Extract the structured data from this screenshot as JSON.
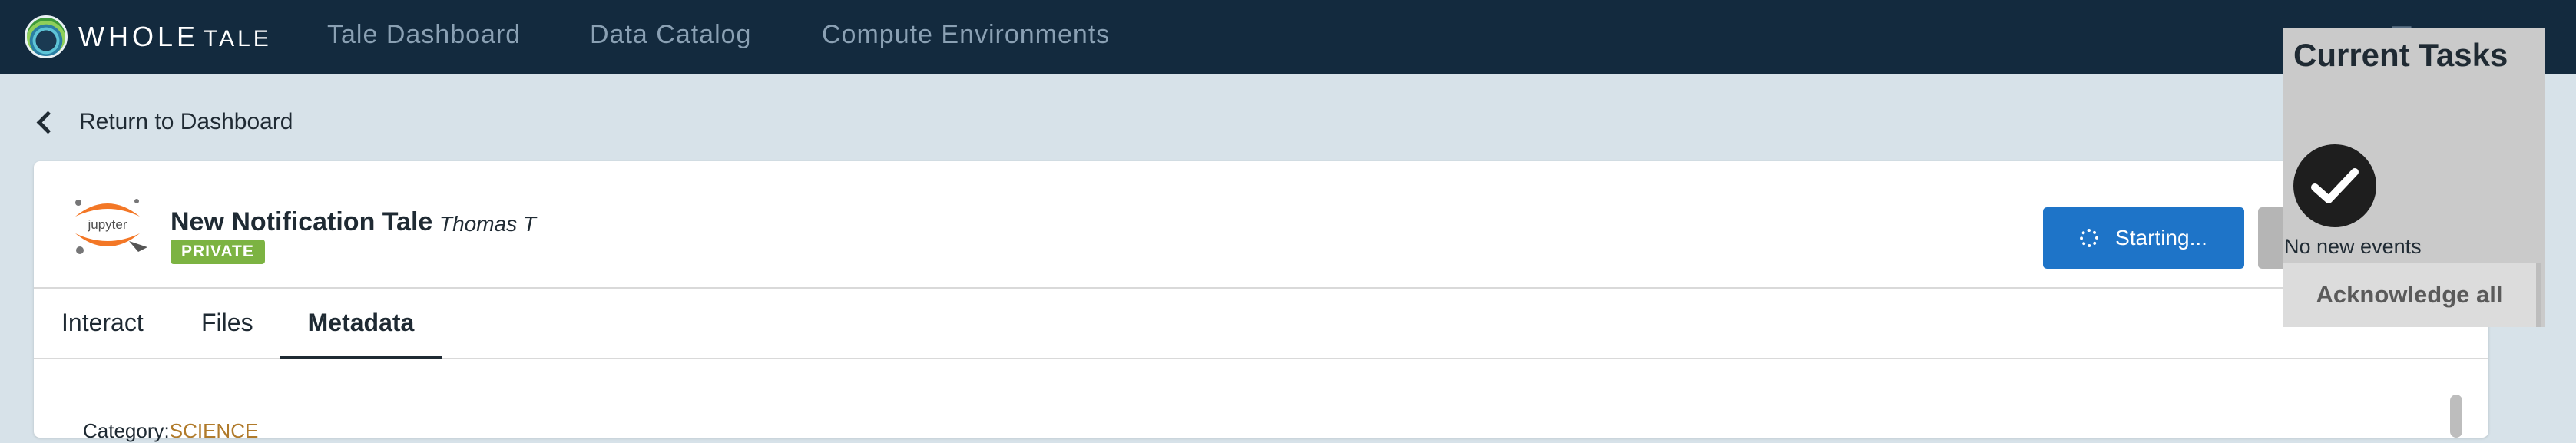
{
  "app": {
    "logo_word_1": "WHOLE",
    "logo_word_2": "TALE"
  },
  "nav": {
    "items": [
      "Tale Dashboard",
      "Data Catalog",
      "Compute Environments"
    ]
  },
  "return_link": "Return to Dashboard",
  "tale": {
    "icon_text": "jupyter",
    "title": "New Notification Tale",
    "author": "Thomas T",
    "visibility": "PRIVATE",
    "start_button": "Starting..."
  },
  "tabs": [
    {
      "label": "Interact",
      "active": false
    },
    {
      "label": "Files",
      "active": false
    },
    {
      "label": "Metadata",
      "active": true
    }
  ],
  "metadata": {
    "category_label": "Category:",
    "category_value": "SCIENCE"
  },
  "tasks_panel": {
    "title": "Current Tasks",
    "status_icon": "check-circle-icon",
    "empty_message": "No new events",
    "acknowledge_label": "Acknowledge all"
  },
  "colors": {
    "topbar": "#132a3e",
    "page_bg": "#d7e2e9",
    "primary_button": "#1e74c8",
    "private_badge": "#7cb342",
    "category_value": "#b07a2a"
  }
}
